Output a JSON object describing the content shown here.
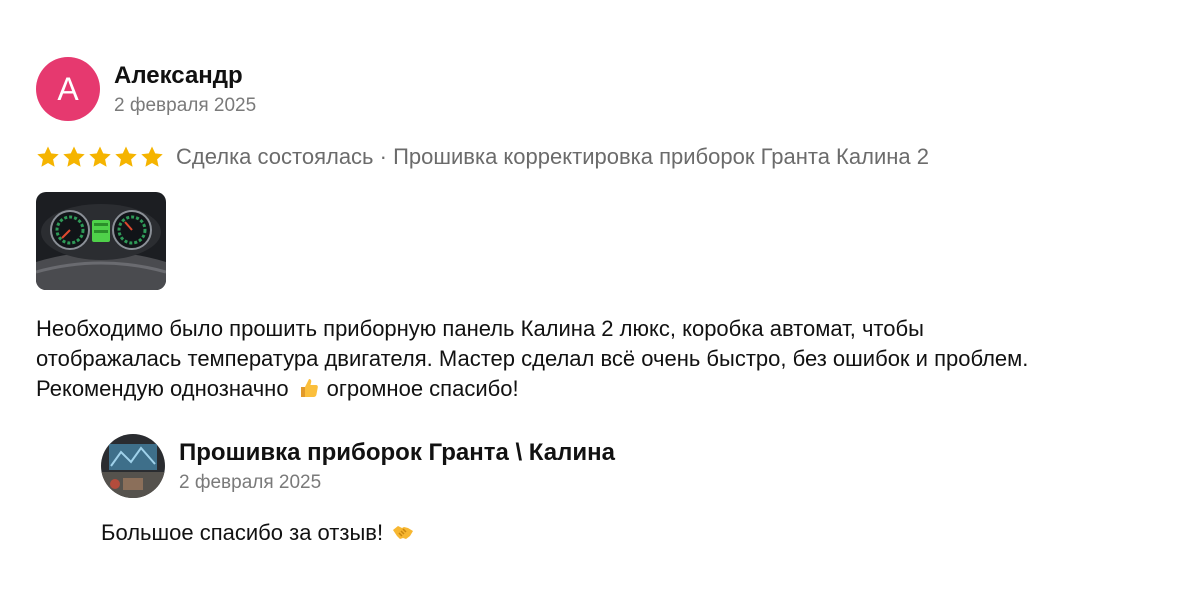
{
  "review": {
    "author": {
      "initial": "А",
      "name": "Александр",
      "avatar_color": "#e6396f"
    },
    "date": "2 февраля 2025",
    "rating": 5,
    "rating_max": 5,
    "star_color": "#f5b400",
    "deal_text": "Сделка состоялась · Прошивка корректировка приборок Гранта Калина 2",
    "photo": {
      "icon": "dashboard-photo"
    },
    "text_parts": {
      "line1": "Необходимо было прошить приборную панель Калина 2 люкс, коробка автомат, чтобы",
      "line2": "отображалась температура двигателя. Мастер сделал всё очень быстро, без ошибок и проблем.",
      "line3_before": "Рекомендую однозначно",
      "emoji": "thumbs-up-emoji",
      "line3_after": "огромное спасибо!"
    }
  },
  "reply": {
    "author": {
      "name": "Прошивка приборок Гранта \\ Калина",
      "avatar_icon": "seller-avatar-photo"
    },
    "date": "2 февраля 2025",
    "text": "Большое спасибо за отзыв!",
    "emoji": "handshake-emoji"
  }
}
